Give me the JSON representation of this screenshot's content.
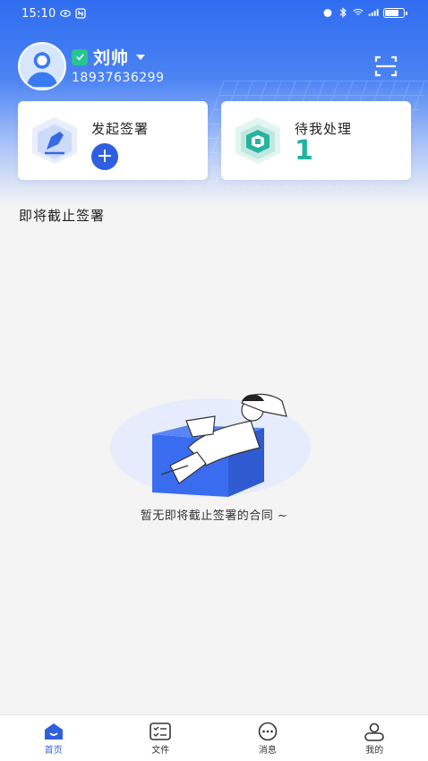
{
  "status_bar": {
    "time": "15:10",
    "battery_level": 0.7
  },
  "user": {
    "name": "刘帅",
    "phone": "18937636299"
  },
  "cards": {
    "initiate": {
      "title": "发起签署",
      "button": "+"
    },
    "pending": {
      "title": "待我处理",
      "count": "1"
    }
  },
  "section": {
    "title": "即将截止签署",
    "empty_text": "暂无即将截止签署的合同 ~"
  },
  "bottom_nav": {
    "items": [
      {
        "label": "首页",
        "icon": "home-icon",
        "active": true
      },
      {
        "label": "文件",
        "icon": "file-icon",
        "active": false
      },
      {
        "label": "消息",
        "icon": "message-icon",
        "active": false
      },
      {
        "label": "我的",
        "icon": "profile-icon",
        "active": false
      }
    ]
  },
  "colors": {
    "primary": "#2f5fe0",
    "accent_green": "#22b3a0",
    "verified_green": "#27c690"
  }
}
